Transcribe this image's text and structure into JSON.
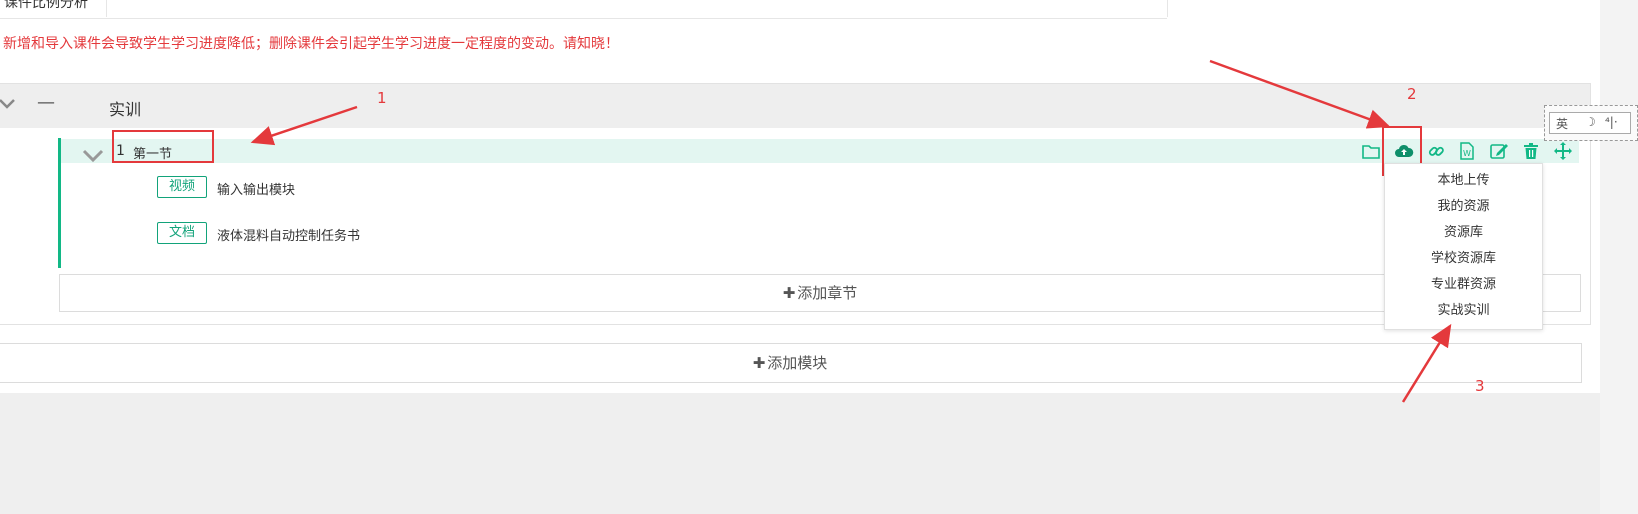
{
  "top_row": {
    "label": "课件比例分析"
  },
  "notice": "新增和导入课件会导致学生学习进度降低；删除课件会引起学生学习进度一定程度的变动。请知晓！",
  "module": {
    "collapse_icon": "chevron-down-icon",
    "dash": "—",
    "title": "实训",
    "section": {
      "number": "1",
      "title": "第一节",
      "tools": [
        "folder-icon",
        "cloud-upload-icon",
        "link-icon",
        "word-doc-icon",
        "edit-icon",
        "trash-icon",
        "move-icon"
      ],
      "resources": [
        {
          "tag": "视频",
          "name": "输入输出模块"
        },
        {
          "tag": "文档",
          "name": "液体混料自动控制任务书"
        }
      ]
    },
    "add_section_label": "添加章节"
  },
  "add_module_label": "添加模块",
  "upload_menu": [
    "本地上传",
    "我的资源",
    "资源库",
    "学校资源库",
    "专业群资源",
    "实战实训"
  ],
  "ime": {
    "lang": "英",
    "moon": "☽",
    "punct": "⁴|·"
  },
  "annotations": [
    "1",
    "2",
    "3"
  ],
  "colors": {
    "accent": "#12b886",
    "annotation": "#e4393c",
    "section_bg": "#e3f6f1"
  }
}
